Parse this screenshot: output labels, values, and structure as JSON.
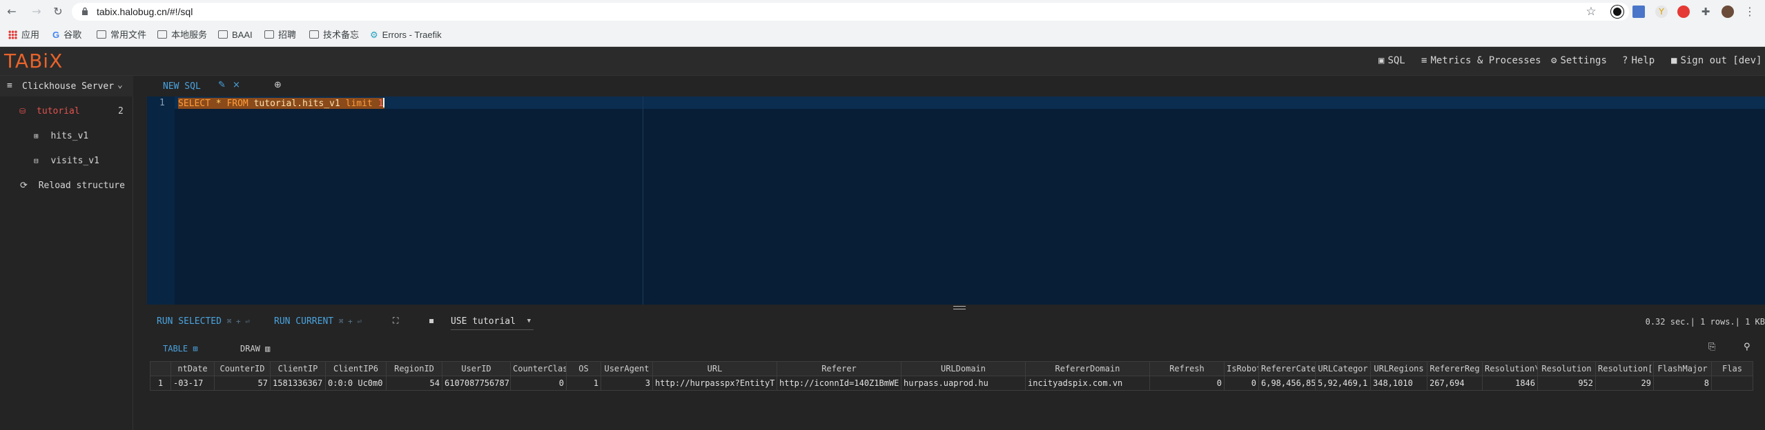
{
  "browser": {
    "url": "tabix.halobug.cn/#!/sql",
    "bookmarks": [
      "应用",
      "谷歌",
      "常用文件",
      "本地服务",
      "BAAI",
      "招聘",
      "技术备忘",
      "Errors - Traefik"
    ]
  },
  "header": {
    "logo": "TABiX",
    "menu": {
      "sql": "SQL",
      "metrics": "Metrics & Processes",
      "settings": "Settings",
      "help": "Help",
      "signout": "Sign out [dev]"
    }
  },
  "sidebar": {
    "server": "Clickhouse Server",
    "database": {
      "name": "tutorial",
      "count": "2"
    },
    "tables": [
      "hits_v1",
      "visits_v1"
    ],
    "reload": "Reload structure"
  },
  "tabs": {
    "active": "NEW SQL"
  },
  "editor": {
    "line": "1",
    "tokens": [
      "SELECT",
      "*",
      "FROM",
      "tutorial.hits_v1",
      "limit",
      "1"
    ]
  },
  "runbar": {
    "run_selected": "RUN SELECTED",
    "run_current": "RUN CURRENT",
    "shortcut_hint": "⌘ + ⏎",
    "db_select": "USE tutorial",
    "stats": "0.32 sec.| 1 rows.| 1 KB"
  },
  "result_tabs": {
    "table": "TABLE",
    "draw": "DRAW"
  },
  "result": {
    "columns": [
      "",
      "ntDate",
      "CounterID",
      "ClientIP",
      "ClientIP6",
      "RegionID",
      "UserID",
      "CounterClas",
      "OS",
      "UserAgent",
      "URL",
      "Referer",
      "URLDomain",
      "RefererDomain",
      "Refresh",
      "IsRobot",
      "RefererCate",
      "URLCategor",
      "URLRegions",
      "RefererReg",
      "Resolution\\",
      "Resolution",
      "Resolution[",
      "FlashMajor",
      "Flas"
    ],
    "rows": [
      [
        "1",
        "-03-17",
        "57",
        "1581336367",
        "0:0:0 Uc0m0",
        "54",
        "6107087756787",
        "0",
        "1",
        "3",
        "http://hurpasspx?EntityT",
        "http://iconnId=140Z1BmWE",
        "hurpass.uaprod.hu",
        "incityadspix.com.vn",
        "0",
        "0",
        "6,98,456,85",
        "5,92,469,1",
        "348,1010",
        "267,694",
        "1846",
        "952",
        "29",
        "8",
        ""
      ]
    ]
  }
}
